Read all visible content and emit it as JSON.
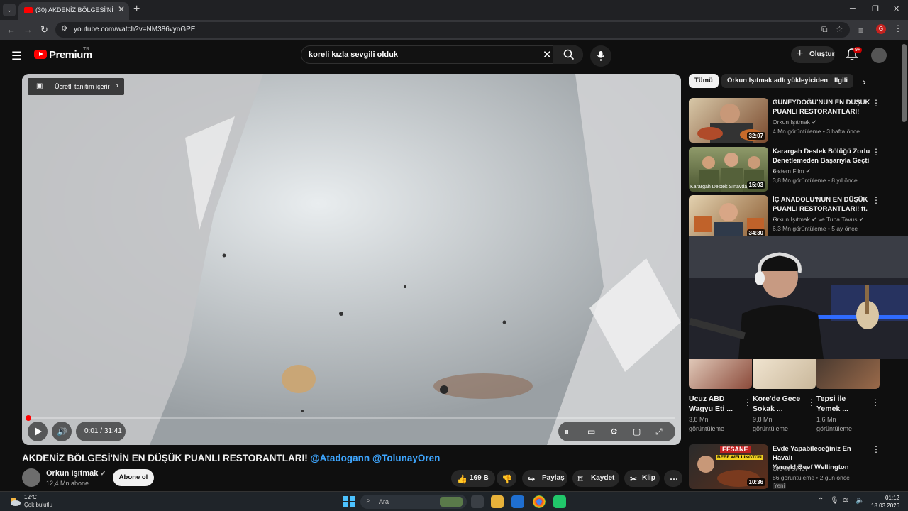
{
  "browser": {
    "tab_title": "(30) AKDENİZ BÖLGESİ'NİN EN",
    "url": "youtube.com/watch?v=NM386vynGPE",
    "profile_initial": "G",
    "tab_list_glyph": "⌄",
    "close_glyph": "✕",
    "new_tab_glyph": "+",
    "back_glyph": "←",
    "forward_glyph": "→",
    "reload_glyph": "↻",
    "menu_glyph": "⋮",
    "minimize_glyph": "─",
    "maximize_glyph": "❐",
    "window_close_glyph": "✕"
  },
  "youtube": {
    "logo_text": "Premium",
    "logo_region": "TR",
    "search_query": "koreli kızla sevgili olduk",
    "create_label": "Oluştur",
    "notifications_badge": "9+"
  },
  "player": {
    "promo_label": "Ücretli tanıtım içerir",
    "current_time": "0:01",
    "duration": "31:41",
    "progress_fraction": 0.0005
  },
  "video": {
    "title": "AKDENİZ BÖLGESİ'NİN EN DÜŞÜK PUANLI RESTORANTLARI!",
    "mention_1": "@Atadogann",
    "mention_2": "@TolunayOren",
    "channel_name": "Orkun Işıtmak",
    "subscribers": "12,4 Mn abone",
    "subscribe_label": "Abone ol",
    "likes": "169 B",
    "share_label": "Paylaş",
    "save_label": "Kaydet",
    "clip_label": "Klip"
  },
  "filters": [
    "Tümü",
    "Orkun Işıtmak adlı yükleyiciden",
    "İlgili"
  ],
  "recommendations": [
    {
      "title_1": "GÜNEYDOĞU'NUN EN DÜŞÜK",
      "title_2": "PUANLI RESTORANTLARI!",
      "channel": "Orkun Işıtmak",
      "meta": "4 Mn görüntüleme • 3 hafta önce",
      "duration": "32:07",
      "color": "#7a4a2e"
    },
    {
      "title_1": "Karargah Destek Bölüğü Zorlu",
      "title_2": "Denetlemeden Başarıyla Geçti ...",
      "channel": "Sistem Film",
      "meta": "3,8 Mn görüntüleme • 8 yıl önce",
      "duration": "15:03",
      "color": "#5a6b3a",
      "thumb_caption": "Karargah Destek Sınavda"
    },
    {
      "title_1": "İÇ ANADOLU'NUN EN DÜŞÜK",
      "title_2": "PUANLI RESTORANTLARI! ft. ...",
      "channel": "Orkun Işıtmak",
      "channel_extra": "ve Tuna Tavus",
      "meta": "6,3 Mn görüntüleme • 5 ay önce",
      "duration": "34:30",
      "color": "#8a5a30"
    },
    {
      "title_1": "Evde Yapabileceğiniz En Havalı",
      "title_2": "Yemek! Beef Wellington",
      "channel": "OKAN DAILY",
      "meta": "86 görüntüleme • 2 gün önce",
      "duration": "10:36",
      "badge": "Yeni",
      "thumb_caption": "EFSANE",
      "thumb_caption_2": "BEEF WELLINGTON",
      "color": "#5e2f1b"
    }
  ],
  "shorts": [
    {
      "title_1": "Ucuz ABD",
      "title_2": "Wagyu Eti ...",
      "views_1": "3,8 Mn",
      "views_2": "görüntüleme",
      "color": "#8b4a3a"
    },
    {
      "title_1": "Kore'de Gece",
      "title_2": "Sokak ...",
      "views_1": "9,8 Mn",
      "views_2": "görüntüleme",
      "color": "#c9b79a"
    },
    {
      "title_1": "Tepsi ile",
      "title_2": "Yemek ...",
      "views_1": "1,6 Mn",
      "views_2": "görüntüleme",
      "color": "#6b4a3a"
    }
  ],
  "taskbar": {
    "temperature": "12°C",
    "condition": "Çok bulutlu",
    "search_placeholder": "Ara",
    "time": "01:12",
    "date": "18.03.2026"
  },
  "colors": {
    "brand_red": "#ff0000",
    "link_blue": "#3ea6ff",
    "background": "#0f0f0f"
  }
}
